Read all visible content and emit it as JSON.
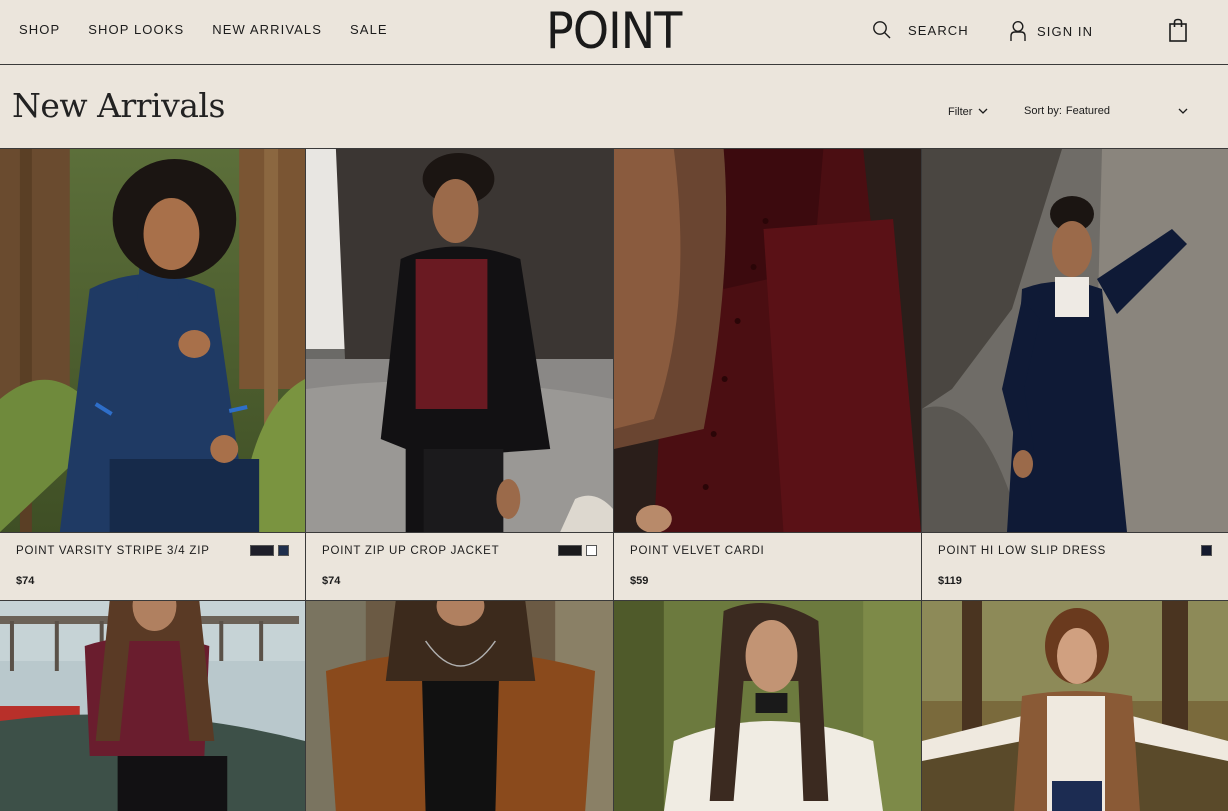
{
  "nav": {
    "items": [
      "SHOP",
      "SHOP LOOKS",
      "NEW ARRIVALS",
      "SALE"
    ]
  },
  "brand": {
    "logo": "POINT"
  },
  "utility": {
    "search_label": "SEARCH",
    "signin_label": "SIGN IN"
  },
  "page": {
    "title": "New Arrivals",
    "filter_label": "Filter",
    "sort_label": "Sort by:",
    "sort_value": "Featured"
  },
  "products": [
    {
      "name": "POINT VARSITY STRIPE 3/4 ZIP",
      "price": "$74",
      "swatches": [
        "#1e1f2a",
        "#1f2f4d"
      ]
    },
    {
      "name": "POINT ZIP UP CROP JACKET",
      "price": "$74",
      "swatches": [
        "#1a1a1c",
        "#ffffff"
      ]
    },
    {
      "name": "POINT VELVET CARDI",
      "price": "$59",
      "swatches": []
    },
    {
      "name": "POINT HI LOW SLIP DRESS",
      "price": "$119",
      "swatches": [
        "#141a2e"
      ]
    },
    {
      "name": "",
      "price": "",
      "swatches": []
    },
    {
      "name": "",
      "price": "",
      "swatches": []
    },
    {
      "name": "",
      "price": "",
      "swatches": []
    },
    {
      "name": "",
      "price": "",
      "swatches": []
    }
  ],
  "icons": {
    "search": "search-icon",
    "user": "user-icon",
    "bag": "shopping-bag-icon",
    "chevron": "chevron-down-icon"
  },
  "colors": {
    "background": "#ebe5dc",
    "text": "#1c1c1c",
    "border": "#3a3a3a"
  }
}
